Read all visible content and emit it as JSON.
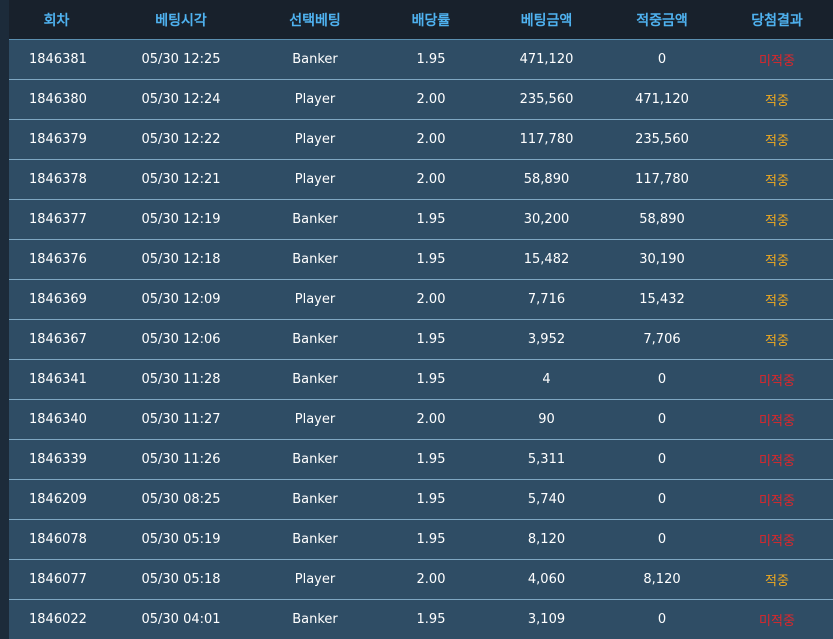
{
  "table": {
    "headers": [
      "회차",
      "베팅시각",
      "선택베팅",
      "배당률",
      "베팅금액",
      "적중금액",
      "당첨결과"
    ],
    "rows": [
      {
        "round": "1846381",
        "time": "05/30 12:25",
        "pick": "Banker",
        "odds": "1.95",
        "bet": "471,120",
        "win": "0",
        "result": "미적중",
        "status": "miss"
      },
      {
        "round": "1846380",
        "time": "05/30 12:24",
        "pick": "Player",
        "odds": "2.00",
        "bet": "235,560",
        "win": "471,120",
        "result": "적중",
        "status": "hit"
      },
      {
        "round": "1846379",
        "time": "05/30 12:22",
        "pick": "Player",
        "odds": "2.00",
        "bet": "117,780",
        "win": "235,560",
        "result": "적중",
        "status": "hit"
      },
      {
        "round": "1846378",
        "time": "05/30 12:21",
        "pick": "Player",
        "odds": "2.00",
        "bet": "58,890",
        "win": "117,780",
        "result": "적중",
        "status": "hit"
      },
      {
        "round": "1846377",
        "time": "05/30 12:19",
        "pick": "Banker",
        "odds": "1.95",
        "bet": "30,200",
        "win": "58,890",
        "result": "적중",
        "status": "hit"
      },
      {
        "round": "1846376",
        "time": "05/30 12:18",
        "pick": "Banker",
        "odds": "1.95",
        "bet": "15,482",
        "win": "30,190",
        "result": "적중",
        "status": "hit"
      },
      {
        "round": "1846369",
        "time": "05/30 12:09",
        "pick": "Player",
        "odds": "2.00",
        "bet": "7,716",
        "win": "15,432",
        "result": "적중",
        "status": "hit"
      },
      {
        "round": "1846367",
        "time": "05/30 12:06",
        "pick": "Banker",
        "odds": "1.95",
        "bet": "3,952",
        "win": "7,706",
        "result": "적중",
        "status": "hit"
      },
      {
        "round": "1846341",
        "time": "05/30 11:28",
        "pick": "Banker",
        "odds": "1.95",
        "bet": "4",
        "win": "0",
        "result": "미적중",
        "status": "miss"
      },
      {
        "round": "1846340",
        "time": "05/30 11:27",
        "pick": "Player",
        "odds": "2.00",
        "bet": "90",
        "win": "0",
        "result": "미적중",
        "status": "miss"
      },
      {
        "round": "1846339",
        "time": "05/30 11:26",
        "pick": "Banker",
        "odds": "1.95",
        "bet": "5,311",
        "win": "0",
        "result": "미적중",
        "status": "miss"
      },
      {
        "round": "1846209",
        "time": "05/30 08:25",
        "pick": "Banker",
        "odds": "1.95",
        "bet": "5,740",
        "win": "0",
        "result": "미적중",
        "status": "miss"
      },
      {
        "round": "1846078",
        "time": "05/30 05:19",
        "pick": "Banker",
        "odds": "1.95",
        "bet": "8,120",
        "win": "0",
        "result": "미적중",
        "status": "miss"
      },
      {
        "round": "1846077",
        "time": "05/30 05:18",
        "pick": "Player",
        "odds": "2.00",
        "bet": "4,060",
        "win": "8,120",
        "result": "적중",
        "status": "hit"
      },
      {
        "round": "1846022",
        "time": "05/30 04:01",
        "pick": "Banker",
        "odds": "1.95",
        "bet": "3,109",
        "win": "0",
        "result": "미적중",
        "status": "miss"
      }
    ]
  },
  "colors": {
    "header_text": "#4fb2f0",
    "row_bg": "#2f4d65",
    "hit": "#f0a91e",
    "miss": "#e0262a"
  }
}
